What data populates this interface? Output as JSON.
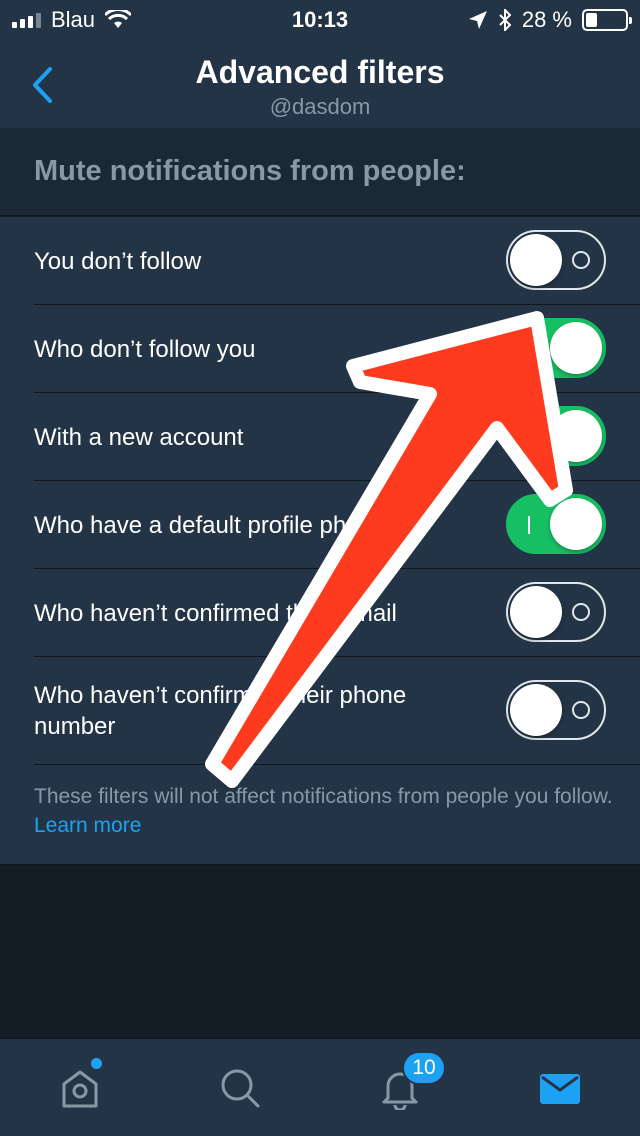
{
  "status_bar": {
    "carrier": "Blau",
    "time": "10:13",
    "battery": "28 %",
    "battery_level": 0.28,
    "icons": [
      "signal-icon",
      "wifi-icon",
      "location-icon",
      "bluetooth-icon",
      "battery-icon"
    ]
  },
  "nav": {
    "back_icon": "chevron-left-icon",
    "title": "Advanced filters",
    "subtitle": "@dasdom"
  },
  "section": {
    "header": "Mute notifications from people:"
  },
  "filters": [
    {
      "label": "You don’t follow",
      "on": false
    },
    {
      "label": "Who don’t follow you",
      "on": true
    },
    {
      "label": "With a new account",
      "on": true
    },
    {
      "label": "Who have a default profile photo",
      "on": true
    },
    {
      "label": "Who haven’t confirmed their email",
      "on": false
    },
    {
      "label": "Who haven’t confirmed their phone number",
      "on": false
    }
  ],
  "footnote": {
    "text": "These filters will not affect notifications from people you follow.",
    "link": "Learn more"
  },
  "tab_bar": {
    "tabs": [
      {
        "name": "home",
        "icon": "home-icon",
        "has_dot": true
      },
      {
        "name": "search",
        "icon": "search-icon"
      },
      {
        "name": "notifications",
        "icon": "bell-icon",
        "badge": "10"
      },
      {
        "name": "messages",
        "icon": "envelope-icon",
        "active": true
      }
    ]
  },
  "colors": {
    "background": "#141d26",
    "surface": "#243447",
    "accent": "#1da1f2",
    "toggle_on": "#17bf63",
    "secondary_text": "#8899a6",
    "arrow": "#ff3b1f"
  }
}
